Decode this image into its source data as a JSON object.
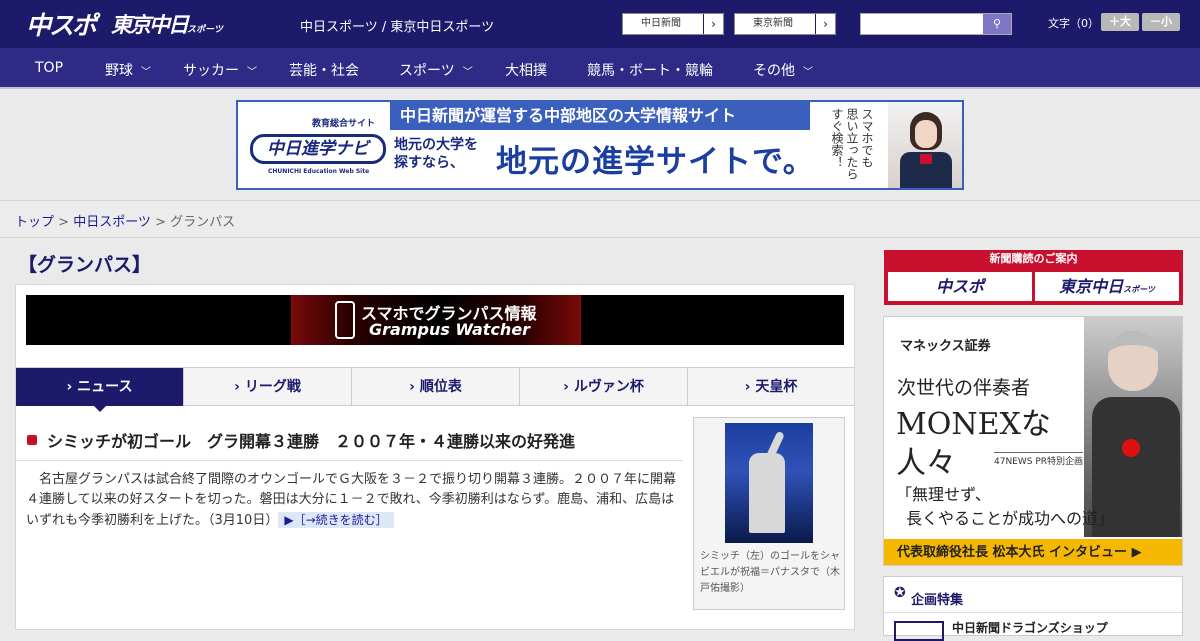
{
  "header": {
    "logo_chuspo": "中スポ",
    "logo_tokyo": "東京中日",
    "logo_tokyo_small": "スポーツ",
    "site_title": "中日スポーツ / 東京中日スポーツ",
    "btn_chunichi": "中日新聞",
    "btn_tokyo": "東京新聞",
    "arrow": "›",
    "search_placeholder": "",
    "search_icon": "⚲",
    "fontsize_label": "文字（0）",
    "fontsize_large": "＋大",
    "fontsize_small": "－小"
  },
  "nav": [
    {
      "label": "TOP",
      "chevron": ""
    },
    {
      "label": "野球",
      "chevron": "﹀"
    },
    {
      "label": "サッカー",
      "chevron": "﹀"
    },
    {
      "label": "芸能・社会",
      "chevron": ""
    },
    {
      "label": "スポーツ",
      "chevron": "﹀"
    },
    {
      "label": "大相撲",
      "chevron": ""
    },
    {
      "label": "競馬・ボート・競輪",
      "chevron": ""
    },
    {
      "label": "その他",
      "chevron": "﹀"
    }
  ],
  "banner": {
    "logo_small": "教育総合サイト",
    "logo_main": "中日進学ナビ",
    "logo_sub": "CHUNICHI Education Web Site",
    "top_text": "中日新聞が運営する中部地区の大学情報サイト",
    "left_text1": "地元の大学を",
    "left_text2": "探すなら、",
    "main_text": "地元の進学サイトで。",
    "vertical1": "スマホでも",
    "vertical2": "思い立ったら",
    "vertical3": "すぐ検索！"
  },
  "breadcrumb": {
    "top": "トップ",
    "sep": " > ",
    "chuspo": "中日スポーツ",
    "current": "グランパス"
  },
  "page_title": "【グランパス】",
  "grampus_banner": {
    "line1": "スマホでグランパス情報",
    "line2": "Grampus Watcher"
  },
  "tabs": [
    {
      "label": "› ニュース",
      "active": true
    },
    {
      "label": "› リーグ戦",
      "active": false
    },
    {
      "label": "› 順位表",
      "active": false
    },
    {
      "label": "› ルヴァン杯",
      "active": false
    },
    {
      "label": "› 天皇杯",
      "active": false
    }
  ],
  "article": {
    "headline": "シミッチが初ゴール　グラ開幕３連勝　２００７年・４連勝以来の好発進",
    "body": "名古屋グランパスは試合終了間際のオウンゴールでＧ大阪を３－２で振り切り開幕３連勝。２００７年に開幕４連勝して以来の好スタートを切った。磐田は大分に１－２で敗れ、今季初勝利はならず。鹿島、浦和、広島はいずれも今季初勝利を上げた。",
    "date": "（3月10日）",
    "more": "▶［→続きを読む］",
    "photo_caption": "シミッチ（左）のゴールをシャビエルが祝福＝パナスタで（木戸佑撮影）"
  },
  "sidebar": {
    "subscribe_head": "新聞購読のご案内",
    "subscribe_chuspo": "中スポ",
    "subscribe_tokyo": "東京中日",
    "subscribe_tokyo_small": "スポーツ",
    "monex_logo": "マネックス証券",
    "monex_line1": "次世代の伴奏者",
    "monex_line2": "MONEXな",
    "monex_line3": "人々",
    "monex_pr": "47NEWS PR特別企画",
    "monex_quote1": "「無理せず、",
    "monex_quote2": "長くやることが成功への道」",
    "monex_bar": "代表取締役社長 松本大氏 インタビュー ▶",
    "feature_title": "企画特集",
    "feature_item": "中日新聞ドラゴンズショップ"
  }
}
